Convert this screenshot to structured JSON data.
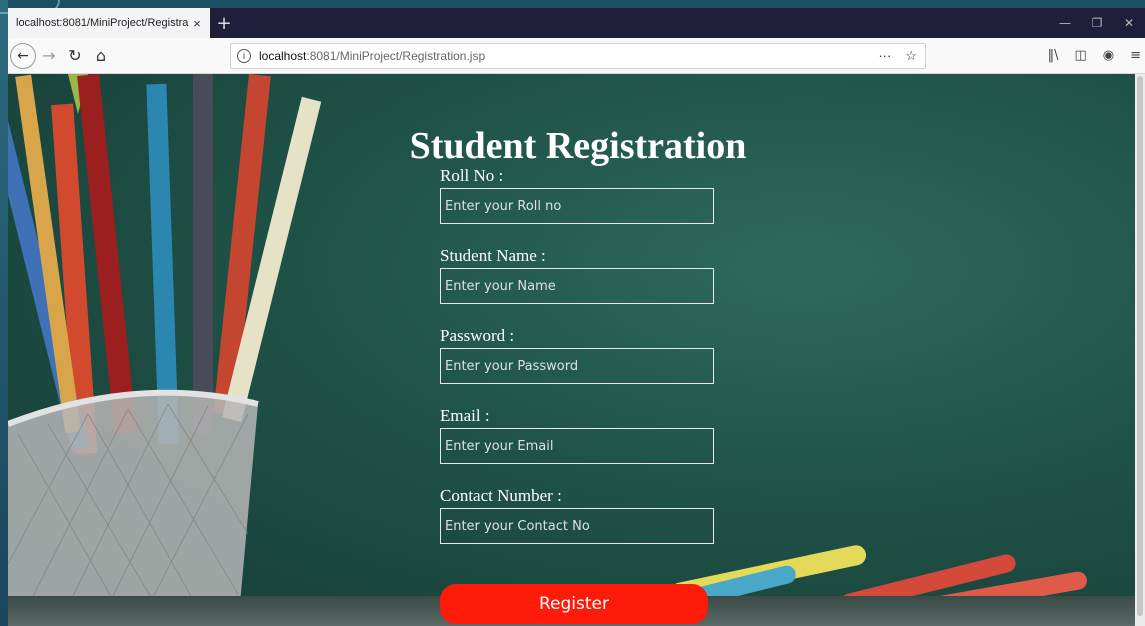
{
  "browser": {
    "tab_title": "localhost:8081/MiniProject/Registra",
    "tab_close": "×",
    "new_tab": "+",
    "url_host": "localhost",
    "url_rest": ":8081/MiniProject/Registration.jsp",
    "more": "···",
    "icons": {
      "back": "back-arrow-icon",
      "forward": "forward-arrow-icon",
      "reload": "reload-icon",
      "home": "home-icon",
      "info": "info-icon",
      "bookmark": "star-icon",
      "library": "library-icon",
      "sidebar": "sidebar-icon",
      "account": "account-icon",
      "menu": "hamburger-menu-icon"
    },
    "window_controls": [
      "minimize",
      "restore",
      "close"
    ]
  },
  "page": {
    "title": "Student Registration",
    "fields": [
      {
        "label": "Roll No :",
        "placeholder": "Enter your Roll no"
      },
      {
        "label": "Student Name :",
        "placeholder": "Enter your Name"
      },
      {
        "label": "Password :",
        "placeholder": "Enter your Password"
      },
      {
        "label": "Email :",
        "placeholder": "Enter your Email"
      },
      {
        "label": "Contact Number :",
        "placeholder": "Enter your Contact No"
      }
    ],
    "submit_label": "Register",
    "colors": {
      "background": "#1f5247",
      "register_button": "#ff1a0a",
      "text": "#ffffff"
    }
  }
}
